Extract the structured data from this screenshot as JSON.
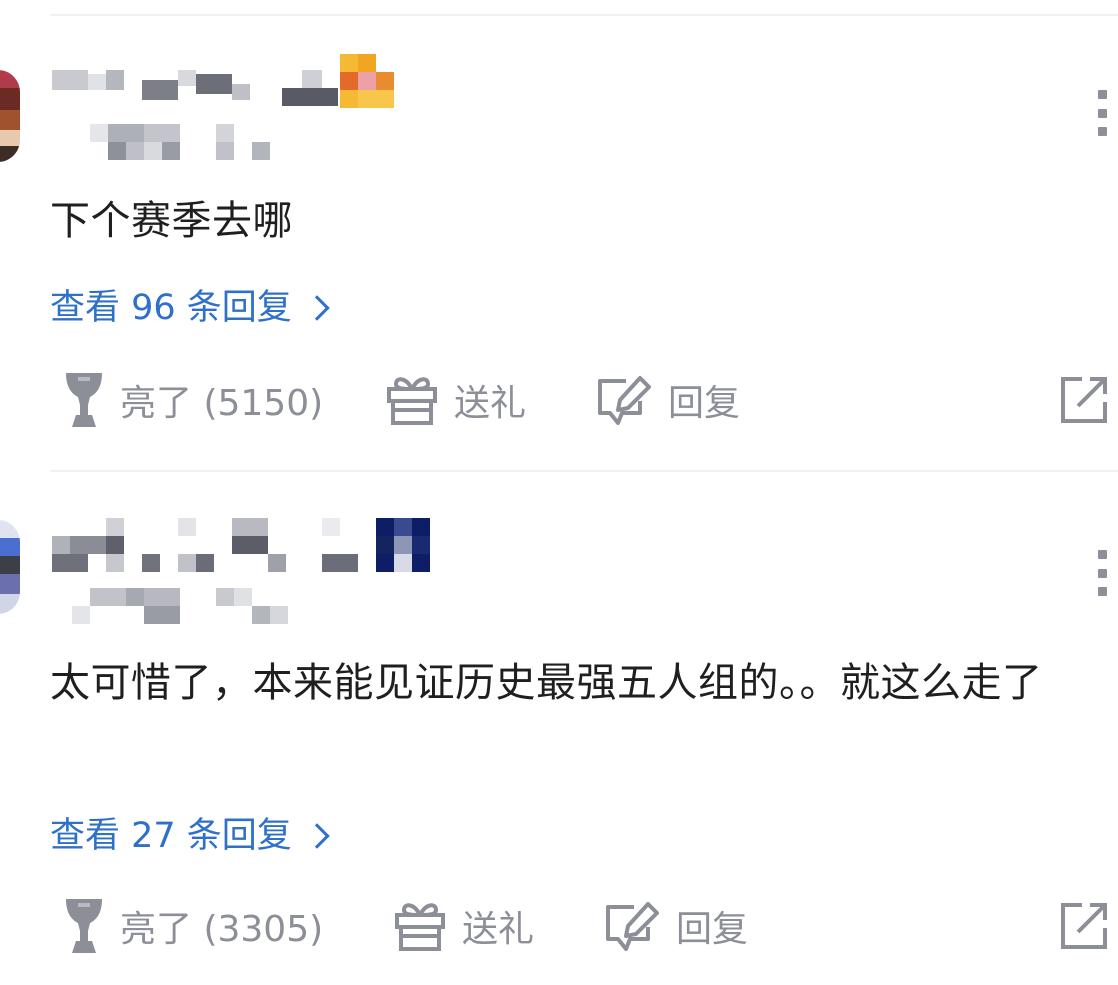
{
  "comments": [
    {
      "text": "下个赛季去哪",
      "view_replies": "查看 96 条回复",
      "like_label": "亮了 (5150)",
      "gift_label": "送礼",
      "reply_label": "回复",
      "icons": {
        "like": "trophy-icon",
        "gift": "gift-icon",
        "reply": "edit-reply-icon",
        "share": "share-icon",
        "more": "more-vertical-icon"
      }
    },
    {
      "text": "太可惜了，本来能见证历史最强五人组的。。就这么走了",
      "view_replies": "查看 27 条回复",
      "like_label": "亮了 (3305)",
      "gift_label": "送礼",
      "reply_label": "回复",
      "icons": {
        "like": "trophy-icon",
        "gift": "gift-icon",
        "reply": "edit-reply-icon",
        "share": "share-icon",
        "more": "more-vertical-icon"
      }
    }
  ],
  "colors": {
    "link": "#2f70c9",
    "action_gray": "#8c8e98",
    "text": "#1f1f1f",
    "divider": "#f1f1f3"
  }
}
